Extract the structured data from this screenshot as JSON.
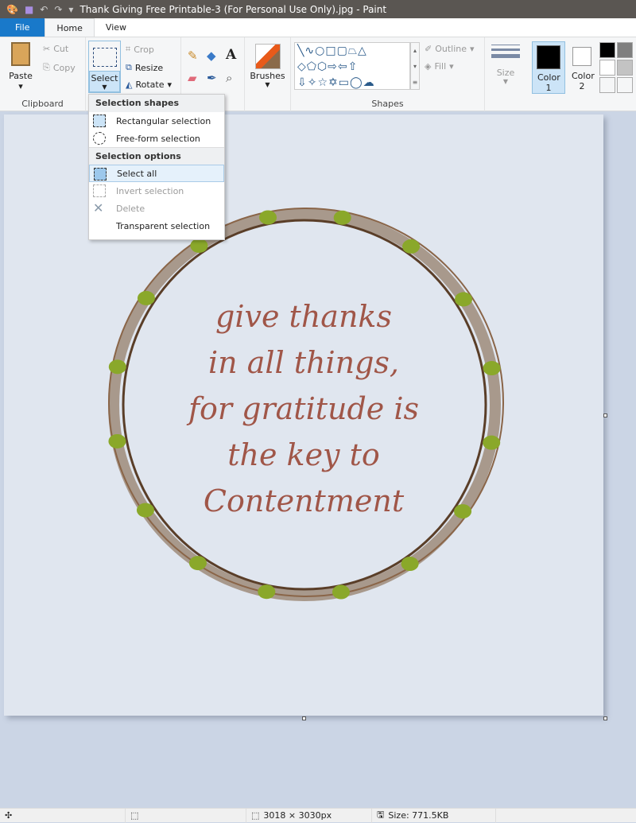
{
  "window": {
    "title": "Thank Giving Free Printable-3 (For Personal Use Only).jpg - Paint"
  },
  "tabs": [
    {
      "label": "File"
    },
    {
      "label": "Home"
    },
    {
      "label": "View"
    }
  ],
  "ribbon": {
    "clipboard": {
      "paste": "Paste",
      "cut": "Cut",
      "copy": "Copy",
      "label": "Clipboard"
    },
    "image": {
      "select": "Select",
      "crop": "Crop",
      "resize": "Resize",
      "rotate": "Rotate"
    },
    "brushes": "Brushes",
    "shapes": {
      "outline": "Outline",
      "fill": "Fill",
      "label": "Shapes"
    },
    "size": "Size",
    "color1": "Color 1",
    "color2": "Color 2",
    "palette": [
      "#000000",
      "#7f7f7f",
      "#ffffff",
      "#c3c3c3",
      "#ffffff",
      "#ffffff"
    ]
  },
  "menu": {
    "section1": "Selection shapes",
    "section2": "Selection options",
    "items": [
      {
        "label": "Rectangular selection"
      },
      {
        "label": "Free-form selection"
      },
      {
        "label": "Select all"
      },
      {
        "label": "Invert selection",
        "disabled": true
      },
      {
        "label": "Delete",
        "disabled": true
      },
      {
        "label": "Transparent selection"
      }
    ]
  },
  "canvas": {
    "quote": [
      "give thanks",
      "in all things,",
      "for gratitude is",
      "the key to",
      "Contentment"
    ],
    "text_color": "#a05648"
  },
  "status": {
    "dimensions": "3018 × 3030px",
    "size": "Size: 771.5KB"
  }
}
